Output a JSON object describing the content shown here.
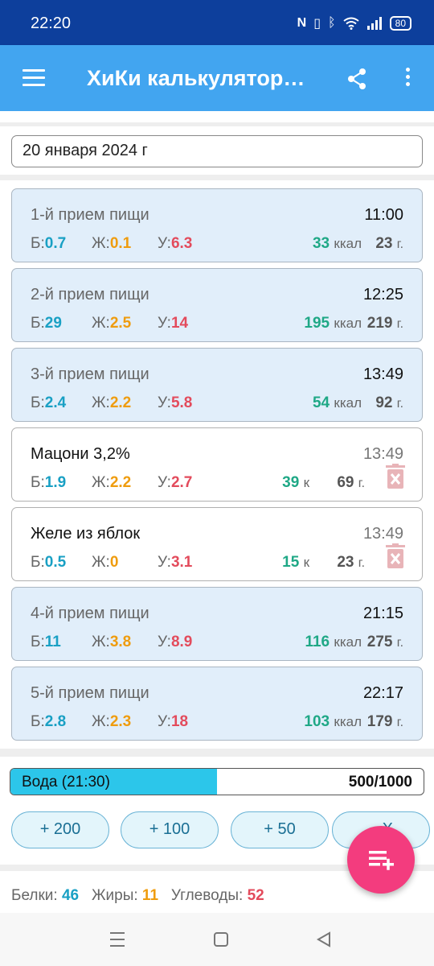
{
  "status": {
    "time": "22:20",
    "battery": "80",
    "icons": [
      "nfc-icon",
      "vibrate-icon",
      "bluetooth-icon",
      "wifi-icon",
      "signal-icon",
      "battery-icon"
    ]
  },
  "appbar": {
    "title": "ХиКи калькулятор…"
  },
  "date": {
    "value": "20 января 2024 г"
  },
  "labels": {
    "protein": "Б:",
    "fat": "Ж:",
    "carbs": "У:",
    "kcal": "ккал",
    "kcal_short": "к",
    "grams": "г."
  },
  "meals": [
    {
      "name": "1-й прием пищи",
      "time": "11:00",
      "p": "0.7",
      "f": "0.1",
      "c": "6.3",
      "kcal": "33",
      "g": "23"
    },
    {
      "name": "2-й прием пищи",
      "time": "12:25",
      "p": "29",
      "f": "2.5",
      "c": "14",
      "kcal": "195",
      "g": "219"
    },
    {
      "name": "3-й прием пищи",
      "time": "13:49",
      "p": "2.4",
      "f": "2.2",
      "c": "5.8",
      "kcal": "54",
      "g": "92"
    },
    {
      "name": "Мацони 3,2%",
      "time": "13:49",
      "p": "1.9",
      "f": "2.2",
      "c": "2.7",
      "kcal": "39",
      "g": "69"
    },
    {
      "name": "Желе из яблок",
      "time": "13:49",
      "p": "0.5",
      "f": "0",
      "c": "3.1",
      "kcal": "15",
      "g": "23"
    },
    {
      "name": "4-й прием пищи",
      "time": "21:15",
      "p": "11",
      "f": "3.8",
      "c": "8.9",
      "kcal": "116",
      "g": "275"
    },
    {
      "name": "5-й прием пищи",
      "time": "22:17",
      "p": "2.8",
      "f": "2.3",
      "c": "18",
      "kcal": "103",
      "g": "179"
    }
  ],
  "water": {
    "label": "Вода (21:30)",
    "value": "500/1000",
    "progress": 0.5,
    "buttons": [
      "+ 200",
      "+ 100",
      "+ 50",
      "– Х"
    ]
  },
  "summary": {
    "protein_label": "Белки:",
    "protein": "46",
    "fat_label": "Жиры:",
    "fat": "11",
    "carbs_label": "Углеводы:",
    "carbs": "52"
  },
  "colors": {
    "statusbar": "#0d3f9c",
    "appbar": "#42a5f0",
    "protein": "#19a0c4",
    "fat": "#ef9c0e",
    "carbs": "#e34b5c",
    "kcal": "#1fa886",
    "fab": "#f33c7e",
    "water": "#2cc6ea"
  }
}
